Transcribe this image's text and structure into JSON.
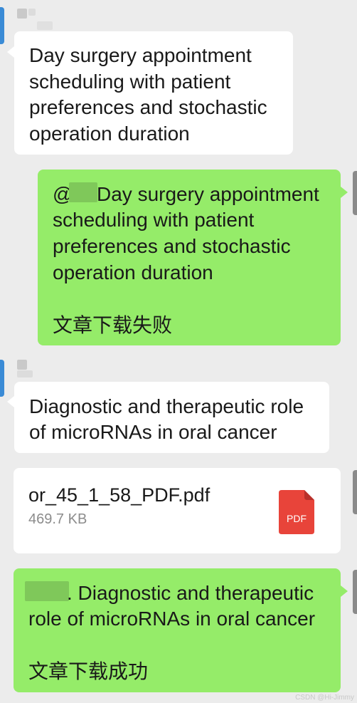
{
  "messages": {
    "m1": {
      "text_lines": [
        "Day surgery appointment",
        "scheduling with patient",
        "preferences and stochastic",
        "operation duration"
      ]
    },
    "m2": {
      "mention": "@",
      "text_lines": [
        "Day surgery appointment",
        "scheduling with patient",
        "preferences and stochastic",
        "operation duration"
      ],
      "status": "文章下载失败"
    },
    "m3": {
      "text_lines": [
        "Diagnostic and therapeutic role",
        "of microRNAs in oral cancer"
      ]
    },
    "m4": {
      "file_name": "or_45_1_58_PDF.pdf",
      "file_size": "469.7 KB",
      "file_type": "PDF"
    },
    "m5": {
      "text_lines": [
        ". Diagnostic and therapeutic",
        "role of microRNAs in oral cancer"
      ],
      "status": "文章下载成功"
    }
  },
  "watermark": "CSDN @Hi-Jimmy",
  "colors": {
    "background": "#ececec",
    "incoming_bubble": "#ffffff",
    "outgoing_bubble": "#95ec69",
    "pdf_icon": "#e8443a"
  }
}
